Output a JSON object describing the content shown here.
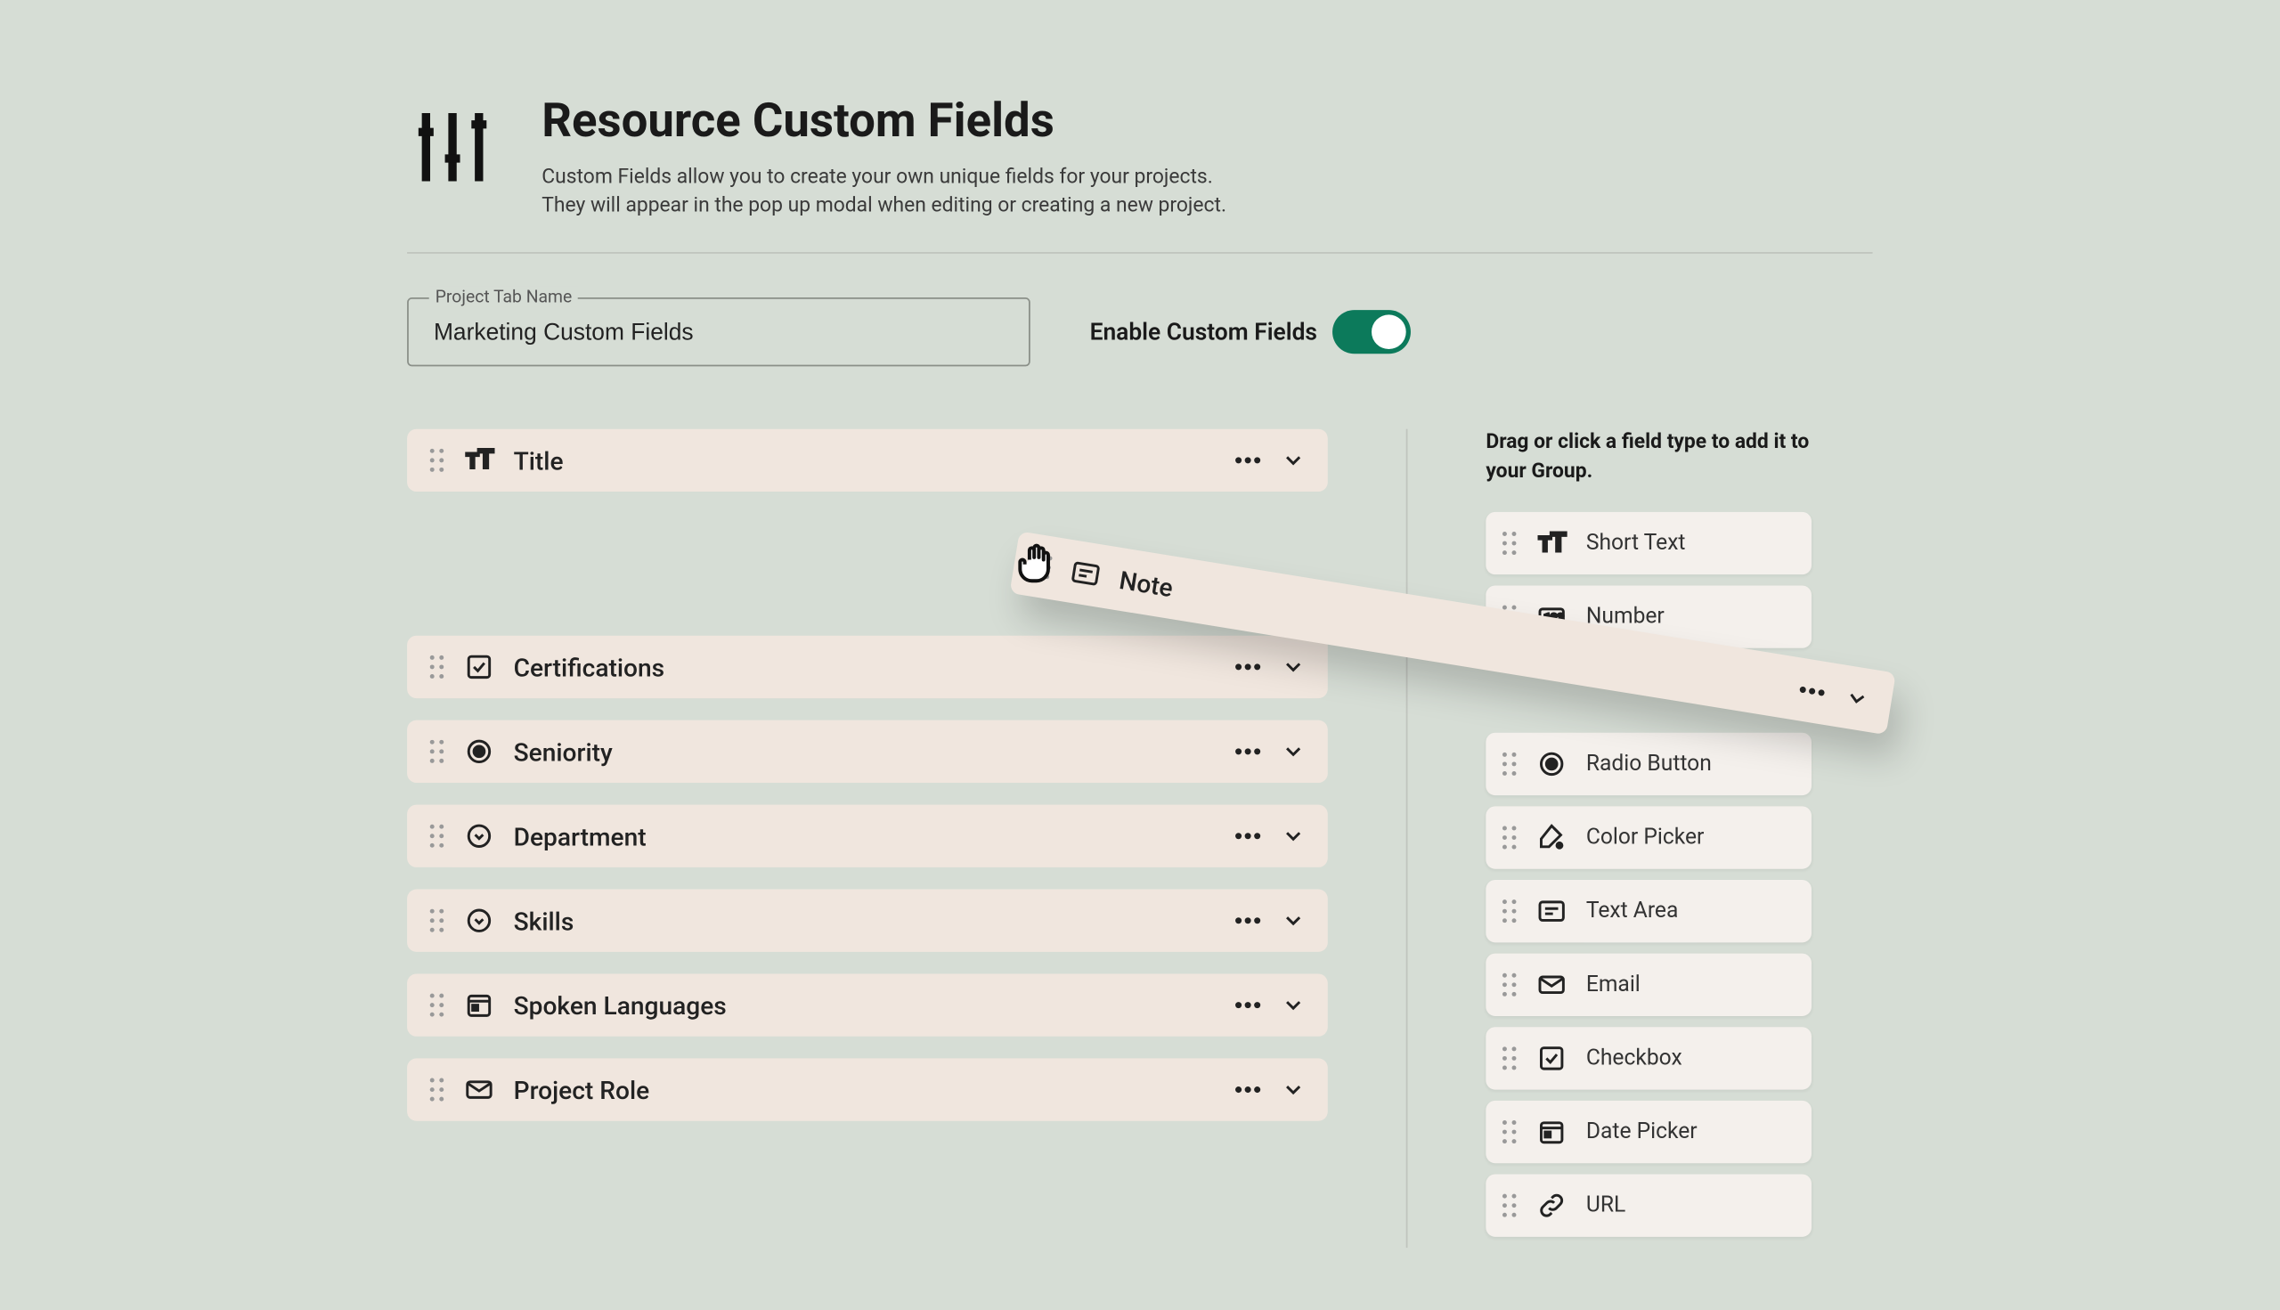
{
  "header": {
    "title": "Resource Custom Fields",
    "desc1": "Custom Fields allow you to create your own unique fields for your projects.",
    "desc2": "They will appear in the pop up modal when editing or creating a new project."
  },
  "tabName": {
    "label": "Project Tab Name",
    "value": "Marketing Custom Fields"
  },
  "enable": {
    "label": "Enable Custom Fields"
  },
  "fields": [
    {
      "label": "Title",
      "icon": "short-text"
    },
    {
      "label": "Certifications",
      "icon": "checkbox"
    },
    {
      "label": "Seniority",
      "icon": "radio"
    },
    {
      "label": "Department",
      "icon": "dropdown"
    },
    {
      "label": "Skills",
      "icon": "dropdown"
    },
    {
      "label": "Spoken Languages",
      "icon": "date"
    },
    {
      "label": "Project Role",
      "icon": "email"
    }
  ],
  "dragging": {
    "label": "Note"
  },
  "typesHeader": "Drag or click a field type to add it to your Group.",
  "types": [
    {
      "label": "Short Text",
      "icon": "short-text"
    },
    {
      "label": "Number",
      "icon": "number"
    },
    {
      "label": "",
      "icon": "hidden"
    },
    {
      "label": "Radio Button",
      "icon": "radio"
    },
    {
      "label": "Color Picker",
      "icon": "color"
    },
    {
      "label": "Text Area",
      "icon": "textarea"
    },
    {
      "label": "Email",
      "icon": "email"
    },
    {
      "label": "Checkbox",
      "icon": "checkbox"
    },
    {
      "label": "Date Picker",
      "icon": "date"
    },
    {
      "label": "URL",
      "icon": "url"
    }
  ]
}
